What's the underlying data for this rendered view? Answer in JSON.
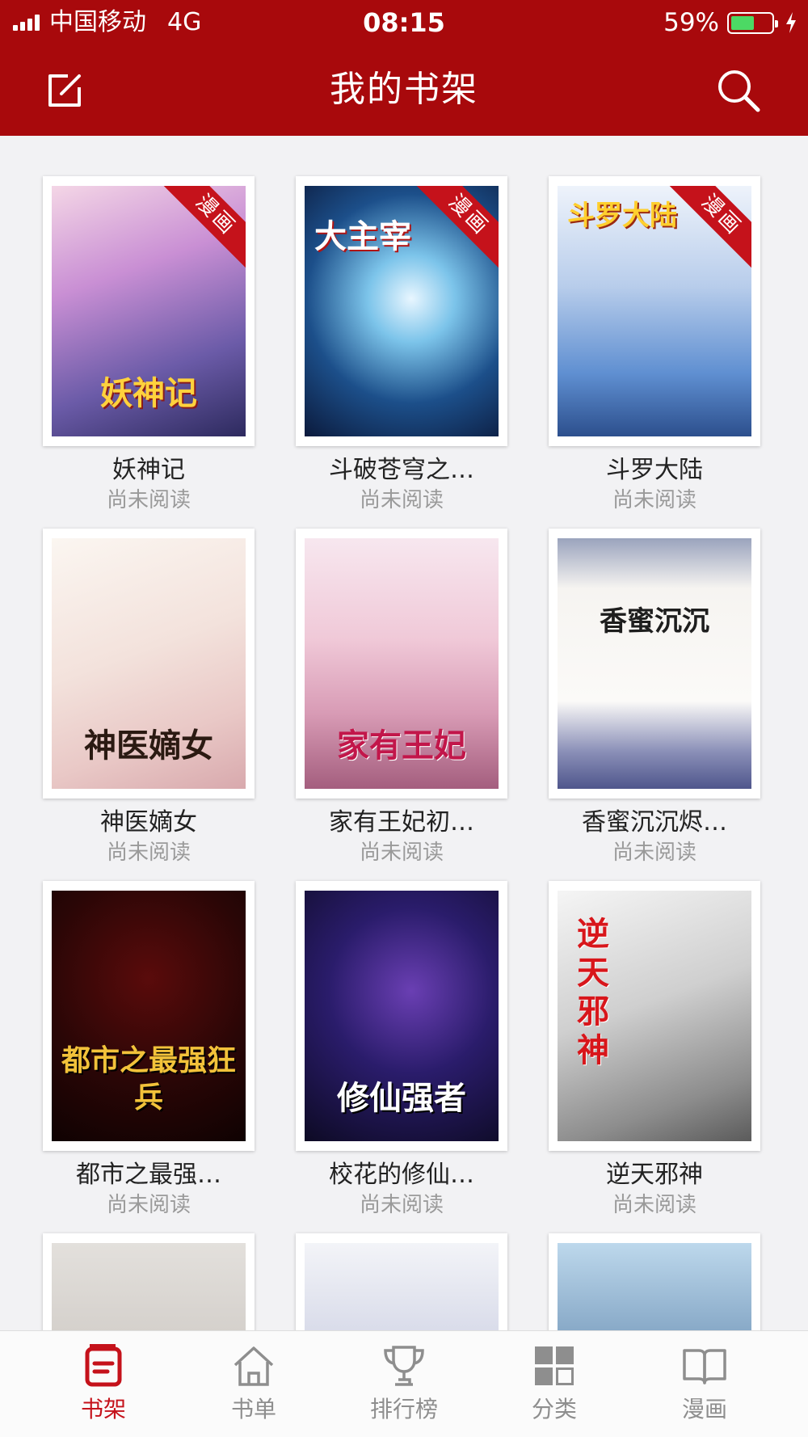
{
  "status_bar": {
    "carrier": "中国移动",
    "network": "4G",
    "time": "08:15",
    "battery_percent": "59%",
    "battery_level": 0.59
  },
  "header": {
    "title": "我的书架",
    "edit_icon": "edit-icon",
    "search_icon": "search-icon",
    "background_color": "#a8090c"
  },
  "books": [
    {
      "name": "妖神记",
      "status": "尚未阅读",
      "badge": "漫画",
      "cover_text": "妖神记"
    },
    {
      "name": "斗破苍穹之…",
      "status": "尚未阅读",
      "badge": "漫画",
      "cover_text": "大主宰"
    },
    {
      "name": "斗罗大陆",
      "status": "尚未阅读",
      "badge": "漫画",
      "cover_text": "斗罗大陆"
    },
    {
      "name": "神医嫡女",
      "status": "尚未阅读",
      "badge": "",
      "cover_text": "神医嫡女"
    },
    {
      "name": "家有王妃初…",
      "status": "尚未阅读",
      "badge": "",
      "cover_text": "家有王妃"
    },
    {
      "name": "香蜜沉沉烬…",
      "status": "尚未阅读",
      "badge": "",
      "cover_text": "香蜜沉沉"
    },
    {
      "name": "都市之最强…",
      "status": "尚未阅读",
      "badge": "",
      "cover_text": "都市之最强狂兵"
    },
    {
      "name": "校花的修仙…",
      "status": "尚未阅读",
      "badge": "",
      "cover_text": "修仙强者"
    },
    {
      "name": "逆天邪神",
      "status": "尚未阅读",
      "badge": "",
      "cover_text": "逆天邪神"
    },
    {
      "name": "",
      "status": "",
      "badge": "",
      "cover_text": ""
    },
    {
      "name": "",
      "status": "",
      "badge": "",
      "cover_text": ""
    },
    {
      "name": "",
      "status": "",
      "badge": "",
      "cover_text": ""
    }
  ],
  "tabbar": {
    "active_color": "#c5121b",
    "tabs": [
      {
        "label": "书架",
        "icon": "bookshelf-icon",
        "active": true
      },
      {
        "label": "书单",
        "icon": "house-icon",
        "active": false
      },
      {
        "label": "排行榜",
        "icon": "trophy-icon",
        "active": false
      },
      {
        "label": "分类",
        "icon": "grid-icon",
        "active": false
      },
      {
        "label": "漫画",
        "icon": "open-book-icon",
        "active": false
      }
    ]
  }
}
